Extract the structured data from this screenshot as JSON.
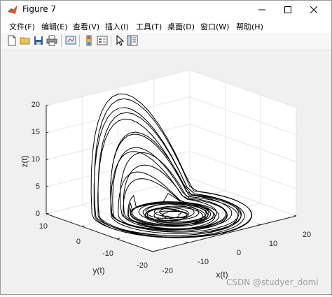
{
  "window": {
    "title": "Figure 7"
  },
  "menu": [
    {
      "label": "文件(F)"
    },
    {
      "label": "编辑(E)"
    },
    {
      "label": "查看(V)"
    },
    {
      "label": "插入(I)"
    },
    {
      "label": "工具(T)"
    },
    {
      "label": "桌面(D)"
    },
    {
      "label": "窗口(W)"
    },
    {
      "label": "帮助(H)"
    }
  ],
  "toolbar": [
    "new-file-icon",
    "open-folder-icon",
    "save-icon",
    "print-icon",
    "link-plot-icon",
    "insert-colorbar-icon",
    "insert-legend-icon",
    "pointer-icon",
    "property-inspector-icon"
  ],
  "chart_data": {
    "type": "line",
    "title": "",
    "xlabel": "x(t)",
    "ylabel": "y(t)",
    "zlabel": "z(t)",
    "xlim": [
      -20,
      20
    ],
    "ylim": [
      -20,
      10
    ],
    "zlim": [
      0,
      20
    ],
    "x_ticks": [
      "-20",
      "-10",
      "0",
      "10",
      "20"
    ],
    "y_ticks": [
      "-20",
      "-10",
      "0",
      "10"
    ],
    "z_ticks": [
      "0",
      "5",
      "10",
      "15",
      "20"
    ],
    "grid": true,
    "view": "3d",
    "series": [
      {
        "values": []
      }
    ]
  },
  "watermark": "CSDN @studyer_domi"
}
